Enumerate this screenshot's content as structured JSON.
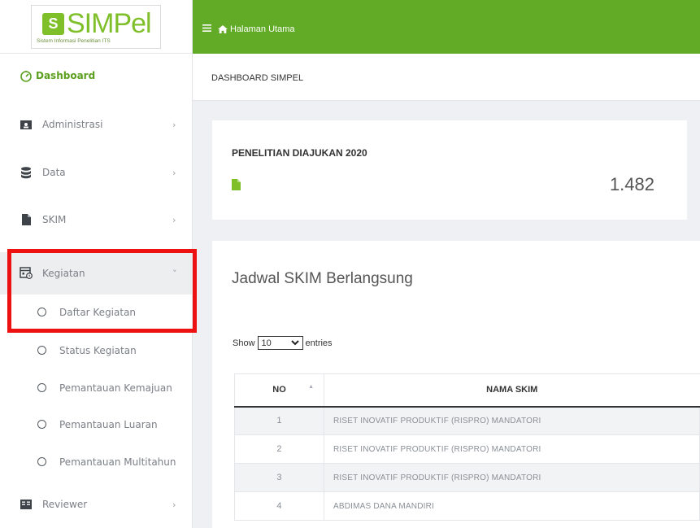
{
  "app": {
    "brand": "SIMPel",
    "logo_mark": "S",
    "tagline": "Sistem Informasi Penelitian ITS"
  },
  "topbar": {
    "home_label": "Halaman Utama",
    "menu_icon": "hamburger-icon",
    "home_icon": "home-icon",
    "color": "#61ab26"
  },
  "breadcrumb": "DASHBOARD SIMPEL",
  "sidebar": {
    "items": [
      {
        "label": "Dashboard",
        "icon": "dashboard-icon",
        "active": true
      },
      {
        "label": "Administrasi",
        "icon": "id-card-icon",
        "chevron": "›"
      },
      {
        "label": "Data",
        "icon": "database-icon",
        "chevron": "›"
      },
      {
        "label": "SKIM",
        "icon": "file-icon",
        "chevron": "›"
      },
      {
        "label": "Kegiatan",
        "icon": "calendar-icon",
        "chevron": "˅",
        "open": true
      },
      {
        "label": "Reviewer",
        "icon": "book-icon",
        "chevron": "›"
      }
    ],
    "kegiatan_sub": [
      {
        "label": "Daftar Kegiatan"
      },
      {
        "label": "Status Kegiatan"
      },
      {
        "label": "Pemantauan Kemajuan"
      },
      {
        "label": "Pemantauan Luaran"
      },
      {
        "label": "Pemantauan Multitahun"
      }
    ]
  },
  "stat_card": {
    "title": "PENELITIAN DIAJUKAN 2020",
    "value": "1.482",
    "icon": "document-icon"
  },
  "schedule": {
    "title": "Jadwal SKIM Berlangsung",
    "show_label": "Show",
    "entries_value": "10",
    "entries_label": "entries",
    "columns": [
      "NO",
      "NAMA SKIM"
    ],
    "rows": [
      {
        "no": "1",
        "name": "RISET INOVATIF PRODUKTIF (RISPRO) MANDATORI"
      },
      {
        "no": "2",
        "name": "RISET INOVATIF PRODUKTIF (RISPRO) MANDATORI"
      },
      {
        "no": "3",
        "name": "RISET INOVATIF PRODUKTIF (RISPRO) MANDATORI"
      },
      {
        "no": "4",
        "name": "ABDIMAS DANA MANDIRI"
      }
    ]
  },
  "colors": {
    "accent": "#61ab26",
    "highlight": "#ee1111"
  }
}
